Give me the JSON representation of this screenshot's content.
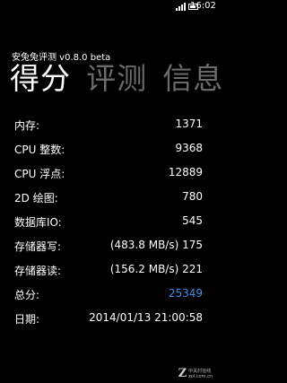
{
  "status_bar": {
    "time": "16:02",
    "signal_icon": "signal-bars-icon",
    "battery_icon": "battery-icon"
  },
  "app": {
    "title": "安兔兔评测 v0.8.0 beta"
  },
  "pivot": {
    "tabs": [
      {
        "label": "得分",
        "active": true
      },
      {
        "label": "评测",
        "active": false
      },
      {
        "label": "信息",
        "active": false
      }
    ]
  },
  "results": [
    {
      "label": "内存:",
      "value": "1371"
    },
    {
      "label": "CPU 整数:",
      "value": "9368"
    },
    {
      "label": "CPU 浮点:",
      "value": "12889"
    },
    {
      "label": "2D 绘图:",
      "value": "780"
    },
    {
      "label": "数据库IO:",
      "value": "545"
    },
    {
      "label": "存储器写:",
      "value": "(483.8 MB/s)  175"
    },
    {
      "label": "存储器读:",
      "value": "(156.2 MB/s)  221"
    },
    {
      "label": "总分:",
      "value": "25349"
    },
    {
      "label": "日期:",
      "value": "2014/01/13 21:00:58"
    }
  ],
  "colors": {
    "background": "#000000",
    "text": "#ffffff",
    "inactive_tab": "#6b6b6b",
    "accent": "#3b8ee8"
  },
  "watermark": {
    "logo": "Z",
    "line1": "中关村在线",
    "line2": "zol.com.cn"
  }
}
